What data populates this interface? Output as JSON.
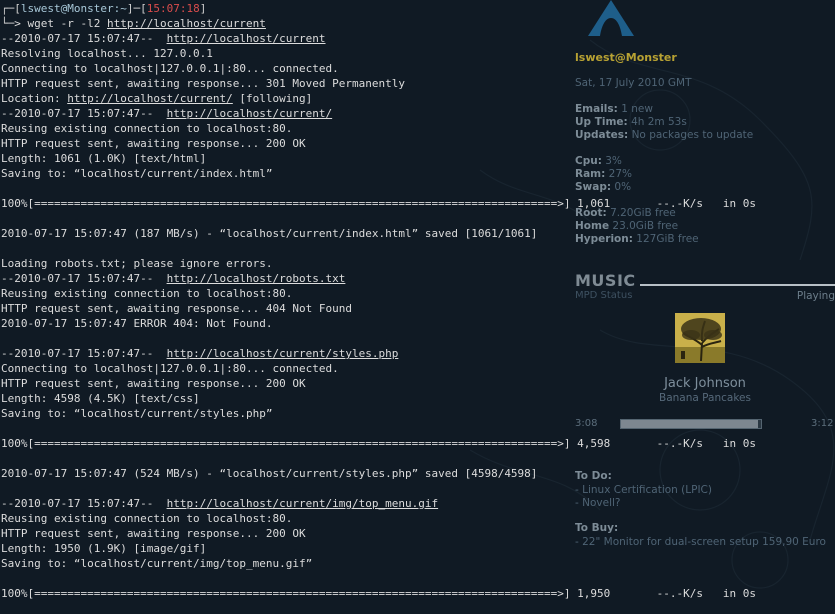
{
  "prompt": {
    "user": "lswest",
    "at": "@",
    "host": "Monster",
    "dir": ":~",
    "time": "15:07:18",
    "arrow": "> ",
    "command": "wget -r -l2 ",
    "url": "http://localhost/current"
  },
  "terminal": {
    "lines": [
      {
        "pre": "--2010-07-17 15:07:47--  ",
        "link": "http://localhost/current",
        "post": ""
      },
      {
        "pre": "Resolving localhost... 127.0.0.1",
        "link": "",
        "post": ""
      },
      {
        "pre": "Connecting to localhost|127.0.0.1|:80... connected.",
        "link": "",
        "post": ""
      },
      {
        "pre": "HTTP request sent, awaiting response... 301 Moved Permanently",
        "link": "",
        "post": ""
      },
      {
        "pre": "Location: ",
        "link": "http://localhost/current/",
        "post": " [following]"
      },
      {
        "pre": "--2010-07-17 15:07:47--  ",
        "link": "http://localhost/current/",
        "post": ""
      },
      {
        "pre": "Reusing existing connection to localhost:80.",
        "link": "",
        "post": ""
      },
      {
        "pre": "HTTP request sent, awaiting response... 200 OK",
        "link": "",
        "post": ""
      },
      {
        "pre": "Length: 1061 (1.0K) [text/html]",
        "link": "",
        "post": ""
      },
      {
        "pre": "Saving to: “localhost/current/index.html”",
        "link": "",
        "post": ""
      },
      {
        "pre": "",
        "link": "",
        "post": ""
      },
      {
        "pre": "100%[===============================================================================>] 1,061       --.-K/s   in 0s",
        "link": "",
        "post": ""
      },
      {
        "pre": "",
        "link": "",
        "post": ""
      },
      {
        "pre": "2010-07-17 15:07:47 (187 MB/s) - “localhost/current/index.html” saved [1061/1061]",
        "link": "",
        "post": ""
      },
      {
        "pre": "",
        "link": "",
        "post": ""
      },
      {
        "pre": "Loading robots.txt; please ignore errors.",
        "link": "",
        "post": ""
      },
      {
        "pre": "--2010-07-17 15:07:47--  ",
        "link": "http://localhost/robots.txt",
        "post": ""
      },
      {
        "pre": "Reusing existing connection to localhost:80.",
        "link": "",
        "post": ""
      },
      {
        "pre": "HTTP request sent, awaiting response... 404 Not Found",
        "link": "",
        "post": ""
      },
      {
        "pre": "2010-07-17 15:07:47 ERROR 404: Not Found.",
        "link": "",
        "post": ""
      },
      {
        "pre": "",
        "link": "",
        "post": ""
      },
      {
        "pre": "--2010-07-17 15:07:47--  ",
        "link": "http://localhost/current/styles.php",
        "post": ""
      },
      {
        "pre": "Connecting to localhost|127.0.0.1|:80... connected.",
        "link": "",
        "post": ""
      },
      {
        "pre": "HTTP request sent, awaiting response... 200 OK",
        "link": "",
        "post": ""
      },
      {
        "pre": "Length: 4598 (4.5K) [text/css]",
        "link": "",
        "post": ""
      },
      {
        "pre": "Saving to: “localhost/current/styles.php”",
        "link": "",
        "post": ""
      },
      {
        "pre": "",
        "link": "",
        "post": ""
      },
      {
        "pre": "100%[===============================================================================>] 4,598       --.-K/s   in 0s",
        "link": "",
        "post": ""
      },
      {
        "pre": "",
        "link": "",
        "post": ""
      },
      {
        "pre": "2010-07-17 15:07:47 (524 MB/s) - “localhost/current/styles.php” saved [4598/4598]",
        "link": "",
        "post": ""
      },
      {
        "pre": "",
        "link": "",
        "post": ""
      },
      {
        "pre": "--2010-07-17 15:07:47--  ",
        "link": "http://localhost/current/img/top_menu.gif",
        "post": ""
      },
      {
        "pre": "Reusing existing connection to localhost:80.",
        "link": "",
        "post": ""
      },
      {
        "pre": "HTTP request sent, awaiting response... 200 OK",
        "link": "",
        "post": ""
      },
      {
        "pre": "Length: 1950 (1.9K) [image/gif]",
        "link": "",
        "post": ""
      },
      {
        "pre": "Saving to: “localhost/current/img/top_menu.gif”",
        "link": "",
        "post": ""
      },
      {
        "pre": "",
        "link": "",
        "post": ""
      },
      {
        "pre": "100%[===============================================================================>] 1,950       --.-K/s   in 0s",
        "link": "",
        "post": ""
      }
    ]
  },
  "conky": {
    "user_host": "lswest@Monster",
    "date": "Sat, 17 July 2010 GMT",
    "stats": [
      {
        "key": "Emails:",
        "val": " 1 new"
      },
      {
        "key": "Up Time:",
        "val": " 4h 2m 53s"
      },
      {
        "key": "Updates:",
        "val": " No packages to update"
      }
    ],
    "system": [
      {
        "key": "Cpu:",
        "val": " 3%"
      },
      {
        "key": "Ram:",
        "val": "  27%"
      },
      {
        "key": "Swap:",
        "val": "  0%"
      }
    ],
    "disks": [
      {
        "key": "Root:",
        "val": " 7.20GiB free"
      },
      {
        "key": "Home",
        "val": " 23.0GiB free"
      },
      {
        "key": "Hyperion:",
        "val": " 127GiB free"
      }
    ],
    "music": {
      "heading": "MUSIC",
      "status_label": "MPD Status",
      "state": "Playing",
      "artist": "Jack Johnson",
      "song": "Banana Pancakes",
      "elapsed": "3:08",
      "total": "3:12",
      "progress": 0.98
    },
    "todo": {
      "title": "To Do:",
      "items": [
        "- Linux Certification (LPIC)",
        "- Novell?"
      ]
    },
    "tobuy": {
      "title": "To Buy:",
      "items": [
        "- 22\" Monitor for dual-screen setup 159,90 Euro"
      ]
    },
    "colors": {
      "accent": "#b8a233",
      "text": "#4f6475",
      "bg": "#101a24"
    }
  }
}
